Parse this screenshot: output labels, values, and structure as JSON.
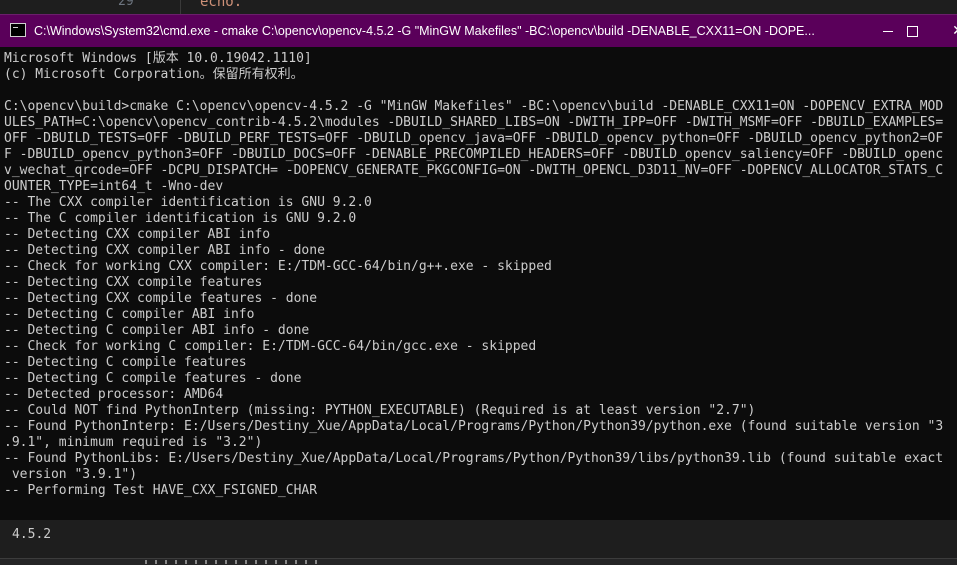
{
  "editor": {
    "line_number": "29",
    "code_snippet": "echo.",
    "output_text": "4.5.2"
  },
  "window": {
    "title": "C:\\Windows\\System32\\cmd.exe - cmake  C:\\opencv\\opencv-4.5.2 -G \"MinGW Makefiles\" -BC:\\opencv\\build -DENABLE_CXX11=ON -DOPE...",
    "minimize_icon": "minimize-icon",
    "maximize_icon": "maximize-icon",
    "close_label": "✕"
  },
  "console": {
    "lines": [
      "Microsoft Windows [版本 10.0.19042.1110]",
      "(c) Microsoft Corporation。保留所有权利。",
      "",
      "C:\\opencv\\build>cmake C:\\opencv\\opencv-4.5.2 -G \"MinGW Makefiles\" -BC:\\opencv\\build -DENABLE_CXX11=ON -DOPENCV_EXTRA_MOD",
      "ULES_PATH=C:\\opencv\\opencv_contrib-4.5.2\\modules -DBUILD_SHARED_LIBS=ON -DWITH_IPP=OFF -DWITH_MSMF=OFF -DBUILD_EXAMPLES=",
      "OFF -DBUILD_TESTS=OFF -DBUILD_PERF_TESTS=OFF -DBUILD_opencv_java=OFF -DBUILD_opencv_python=OFF -DBUILD_opencv_python2=OF",
      "F -DBUILD_opencv_python3=OFF -DBUILD_DOCS=OFF -DENABLE_PRECOMPILED_HEADERS=OFF -DBUILD_opencv_saliency=OFF -DBUILD_openc",
      "v_wechat_qrcode=OFF -DCPU_DISPATCH= -DOPENCV_GENERATE_PKGCONFIG=ON -DWITH_OPENCL_D3D11_NV=OFF -DOPENCV_ALLOCATOR_STATS_C",
      "OUNTER_TYPE=int64_t -Wno-dev",
      "-- The CXX compiler identification is GNU 9.2.0",
      "-- The C compiler identification is GNU 9.2.0",
      "-- Detecting CXX compiler ABI info",
      "-- Detecting CXX compiler ABI info - done",
      "-- Check for working CXX compiler: E:/TDM-GCC-64/bin/g++.exe - skipped",
      "-- Detecting CXX compile features",
      "-- Detecting CXX compile features - done",
      "-- Detecting C compiler ABI info",
      "-- Detecting C compiler ABI info - done",
      "-- Check for working C compiler: E:/TDM-GCC-64/bin/gcc.exe - skipped",
      "-- Detecting C compile features",
      "-- Detecting C compile features - done",
      "-- Detected processor: AMD64",
      "-- Could NOT find PythonInterp (missing: PYTHON_EXECUTABLE) (Required is at least version \"2.7\")",
      "-- Found PythonInterp: E:/Users/Destiny_Xue/AppData/Local/Programs/Python/Python39/python.exe (found suitable version \"3",
      ".9.1\", minimum required is \"3.2\")",
      "-- Found PythonLibs: E:/Users/Destiny_Xue/AppData/Local/Programs/Python/Python39/libs/python39.lib (found suitable exact",
      " version \"3.9.1\")",
      "-- Performing Test HAVE_CXX_FSIGNED_CHAR"
    ]
  }
}
